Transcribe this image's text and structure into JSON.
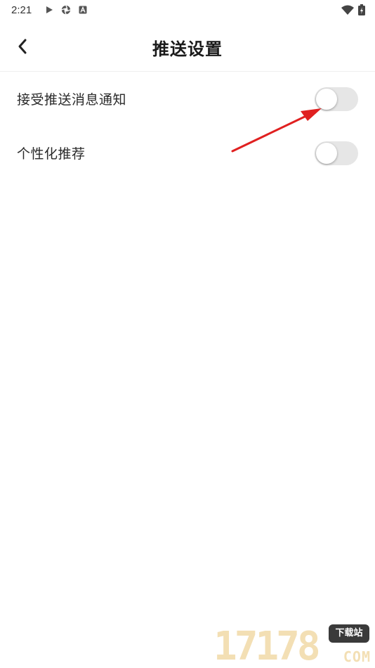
{
  "status_bar": {
    "time": "2:21",
    "left_icons": [
      "play-icon",
      "aperture-icon",
      "a-box-icon"
    ],
    "right_icons": [
      "wifi-icon",
      "battery-icon"
    ]
  },
  "header": {
    "title": "推送设置",
    "back_icon": "chevron-left-icon"
  },
  "settings": [
    {
      "label": "接受推送消息通知",
      "enabled": false
    },
    {
      "label": "个性化推荐",
      "enabled": false
    }
  ],
  "annotation": {
    "color": "#e02020"
  },
  "watermark": {
    "digits": "17178",
    "badge": "下载站",
    "suffix": "COM"
  },
  "colors": {
    "toggle_off": "#e6e6e6",
    "text_primary": "#1a1a1a",
    "watermark": "#f3dfb4"
  }
}
